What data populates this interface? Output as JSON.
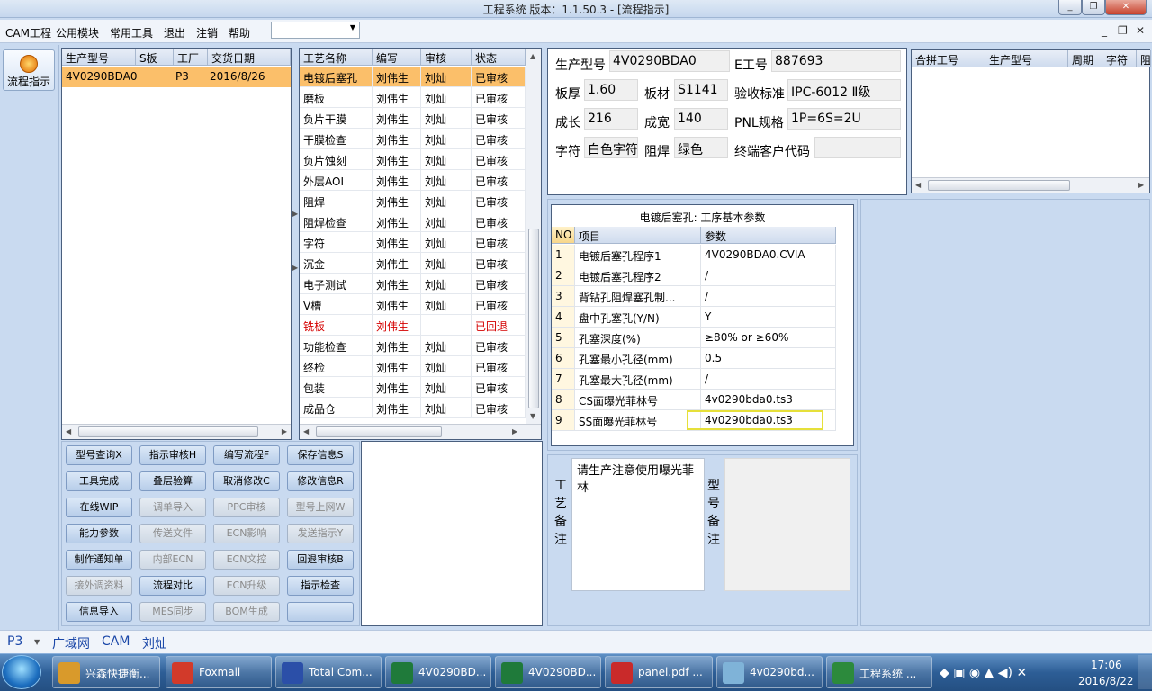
{
  "window": {
    "title": "工程系统  版本：1.1.50.3 - [流程指示]"
  },
  "menubar": {
    "items": [
      "CAM工程",
      "公用模块",
      "常用工具",
      "退出",
      "注销",
      "帮助"
    ],
    "dropdown_value": "",
    "mdi_controls": [
      "_",
      "❐",
      "✕"
    ]
  },
  "toolbar": {
    "flow_button": "流程指示"
  },
  "orders": {
    "headers": [
      "生产型号",
      "S板",
      "工厂",
      "交货日期"
    ],
    "rows": [
      {
        "model": "4V0290BDA0",
        "s": "",
        "factory": "P3",
        "date": "2016/8/26"
      }
    ]
  },
  "process": {
    "headers": [
      "工艺名称",
      "编写",
      "审核",
      "状态"
    ],
    "rows": [
      {
        "name": "电镀后塞孔",
        "writer": "刘伟生",
        "reviewer": "刘灿",
        "status": "已审核",
        "selected": true
      },
      {
        "name": "磨板",
        "writer": "刘伟生",
        "reviewer": "刘灿",
        "status": "已审核"
      },
      {
        "name": "负片干膜",
        "writer": "刘伟生",
        "reviewer": "刘灿",
        "status": "已审核"
      },
      {
        "name": "干膜检查",
        "writer": "刘伟生",
        "reviewer": "刘灿",
        "status": "已审核"
      },
      {
        "name": "负片蚀刻",
        "writer": "刘伟生",
        "reviewer": "刘灿",
        "status": "已审核"
      },
      {
        "name": "外层AOI",
        "writer": "刘伟生",
        "reviewer": "刘灿",
        "status": "已审核"
      },
      {
        "name": "阻焊",
        "writer": "刘伟生",
        "reviewer": "刘灿",
        "status": "已审核"
      },
      {
        "name": "阻焊检查",
        "writer": "刘伟生",
        "reviewer": "刘灿",
        "status": "已审核"
      },
      {
        "name": "字符",
        "writer": "刘伟生",
        "reviewer": "刘灿",
        "status": "已审核"
      },
      {
        "name": "沉金",
        "writer": "刘伟生",
        "reviewer": "刘灿",
        "status": "已审核"
      },
      {
        "name": "电子测试",
        "writer": "刘伟生",
        "reviewer": "刘灿",
        "status": "已审核"
      },
      {
        "name": "V槽",
        "writer": "刘伟生",
        "reviewer": "刘灿",
        "status": "已审核"
      },
      {
        "name": "铣板",
        "writer": "刘伟生",
        "reviewer": "",
        "status": "已回退",
        "red": true
      },
      {
        "name": "功能检查",
        "writer": "刘伟生",
        "reviewer": "刘灿",
        "status": "已审核"
      },
      {
        "name": "终检",
        "writer": "刘伟生",
        "reviewer": "刘灿",
        "status": "已审核"
      },
      {
        "name": "包装",
        "writer": "刘伟生",
        "reviewer": "刘灿",
        "status": "已审核"
      },
      {
        "name": "成品仓",
        "writer": "刘伟生",
        "reviewer": "刘灿",
        "status": "已审核"
      }
    ]
  },
  "buttons": [
    {
      "label": "型号查询X",
      "enabled": true
    },
    {
      "label": "指示审核H",
      "enabled": true
    },
    {
      "label": "编写流程F",
      "enabled": true
    },
    {
      "label": "保存信息S",
      "enabled": true
    },
    {
      "label": "工具完成",
      "enabled": true
    },
    {
      "label": "叠层验算",
      "enabled": true
    },
    {
      "label": "取消修改C",
      "enabled": true
    },
    {
      "label": "修改信息R",
      "enabled": true
    },
    {
      "label": "在线WIP",
      "enabled": true
    },
    {
      "label": "调单导入",
      "enabled": false
    },
    {
      "label": "PPC审核",
      "enabled": false
    },
    {
      "label": "型号上网W",
      "enabled": false
    },
    {
      "label": "能力参数",
      "enabled": true
    },
    {
      "label": "传送文件",
      "enabled": false
    },
    {
      "label": "ECN影响",
      "enabled": false
    },
    {
      "label": "发送指示Y",
      "enabled": false
    },
    {
      "label": "制作通知单",
      "enabled": true
    },
    {
      "label": "内部ECN",
      "enabled": false
    },
    {
      "label": "ECN文控",
      "enabled": false
    },
    {
      "label": "回退审核B",
      "enabled": true
    },
    {
      "label": "接外调资料",
      "enabled": false
    },
    {
      "label": "流程对比",
      "enabled": true
    },
    {
      "label": "ECN升级",
      "enabled": false
    },
    {
      "label": "指示检查",
      "enabled": true
    },
    {
      "label": "信息导入",
      "enabled": true
    },
    {
      "label": "MES同步",
      "enabled": false
    },
    {
      "label": "BOM生成",
      "enabled": false
    },
    {
      "label": "",
      "enabled": true
    }
  ],
  "info": {
    "model_label": "生产型号",
    "model": "4V0290BDA0",
    "eno_label": "E工号",
    "eno": "887693",
    "thickness_label": "板厚",
    "thickness": "1.60",
    "material_label": "板材",
    "material": "S1141",
    "standard_label": "验收标准",
    "standard": "IPC-6012 Ⅱ级",
    "length_label": "成长",
    "length": "216",
    "width_label": "成宽",
    "width": "140",
    "pnl_label": "PNL规格",
    "pnl": "1P=6S=2U",
    "char_label": "字符",
    "char": "白色字符",
    "mask_label": "阻焊",
    "mask": "绿色",
    "endcust_label": "终端客户代码",
    "endcust": ""
  },
  "merge": {
    "headers": [
      "合拼工号",
      "生产型号",
      "周期",
      "字符",
      "阻"
    ]
  },
  "params": {
    "title": "电镀后塞孔: 工序基本参数",
    "headers": [
      "NO",
      "项目",
      "参数"
    ],
    "rows": [
      {
        "no": "1",
        "item": "电镀后塞孔程序1",
        "value": "4V0290BDA0.CVIA"
      },
      {
        "no": "2",
        "item": "电镀后塞孔程序2",
        "value": "/"
      },
      {
        "no": "3",
        "item": "背钻孔阻焊塞孔制...",
        "value": "/"
      },
      {
        "no": "4",
        "item": "盘中孔塞孔(Y/N)",
        "value": "Y"
      },
      {
        "no": "5",
        "item": "孔塞深度(%)",
        "value": "≥80% or ≥60%"
      },
      {
        "no": "6",
        "item": "孔塞最小孔径(mm)",
        "value": "0.5"
      },
      {
        "no": "7",
        "item": "孔塞最大孔径(mm)",
        "value": "/"
      },
      {
        "no": "8",
        "item": "CS面曝光菲林号",
        "value": "4v0290bda0.ts3"
      },
      {
        "no": "9",
        "item": "SS面曝光菲林号",
        "value": "4v0290bda0.ts3",
        "highlight": true
      }
    ]
  },
  "notes": {
    "process_label": "工艺备注",
    "process_text": "请生产注意使用曝光菲林",
    "model_label": "型号备注",
    "model_text": ""
  },
  "statusbar": {
    "factory": "P3",
    "items": [
      "广域网",
      "CAM",
      "刘灿"
    ]
  },
  "taskbar": {
    "tasks": [
      {
        "label": "兴森快捷衡...",
        "color": "#d99a2b"
      },
      {
        "label": "Foxmail",
        "color": "#d23a2a"
      },
      {
        "label": "Total Com...",
        "color": "#2b4fa8"
      },
      {
        "label": "4V0290BD...",
        "color": "#1f7a3a"
      },
      {
        "label": "4V0290BD...",
        "color": "#1f7a3a"
      },
      {
        "label": "panel.pdf ...",
        "color": "#c92a2a"
      },
      {
        "label": "4v0290bd...",
        "color": "#7fb3d8"
      },
      {
        "label": "工程系统 ...",
        "color": "#2c8a3c"
      }
    ],
    "time": "17:06",
    "date": "2016/8/22"
  }
}
